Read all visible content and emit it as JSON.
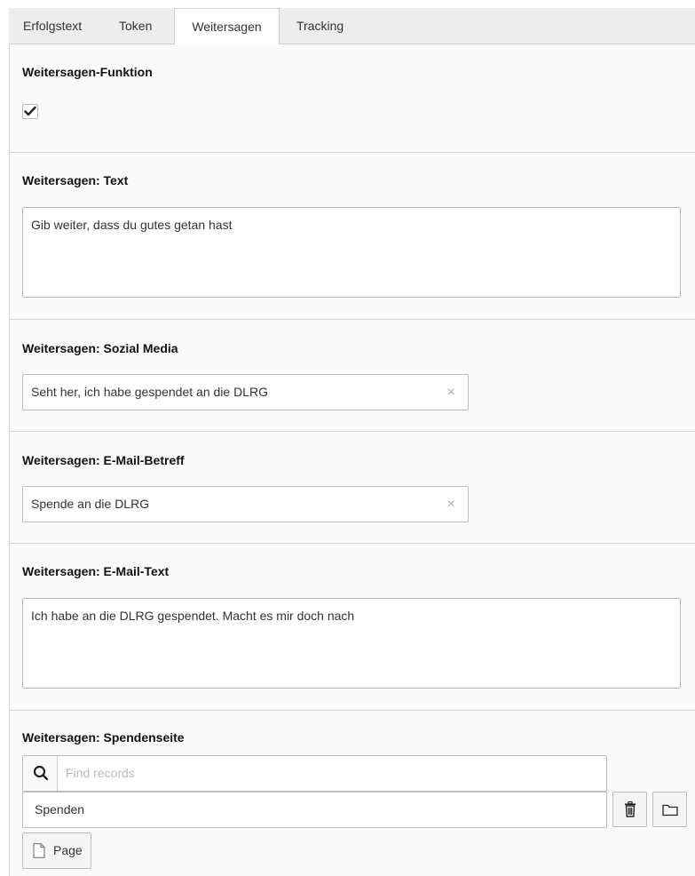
{
  "tabs": [
    {
      "label": "Erfolgstext",
      "active": false
    },
    {
      "label": "Token",
      "active": false
    },
    {
      "label": "Weitersagen",
      "active": true
    },
    {
      "label": "Tracking",
      "active": false
    }
  ],
  "share_function": {
    "label": "Weitersagen-Funktion",
    "checked": true,
    "icon": "checkmark-icon"
  },
  "share_text": {
    "label": "Weitersagen: Text",
    "value": "Gib weiter, dass du gutes getan hast"
  },
  "social_media": {
    "label": "Weitersagen: Sozial Media",
    "value": "Seht her, ich habe gespendet an die DLRG",
    "clear_icon": "×"
  },
  "email_subject": {
    "label": "Weitersagen: E-Mail-Betreff",
    "value": "Spende an die DLRG",
    "clear_icon": "×"
  },
  "email_text": {
    "label": "Weitersagen: E-Mail-Text",
    "value": "Ich habe an die DLRG gespendet. Macht es mir doch nach"
  },
  "donation_page": {
    "label": "Weitersagen: Spendenseite",
    "search_placeholder": "Find records",
    "selected_record": "Spenden",
    "page_button_label": "Page"
  },
  "colors": {
    "tabbar_bg": "#ededed",
    "border": "#bdbdbd",
    "label_text": "#111111"
  }
}
